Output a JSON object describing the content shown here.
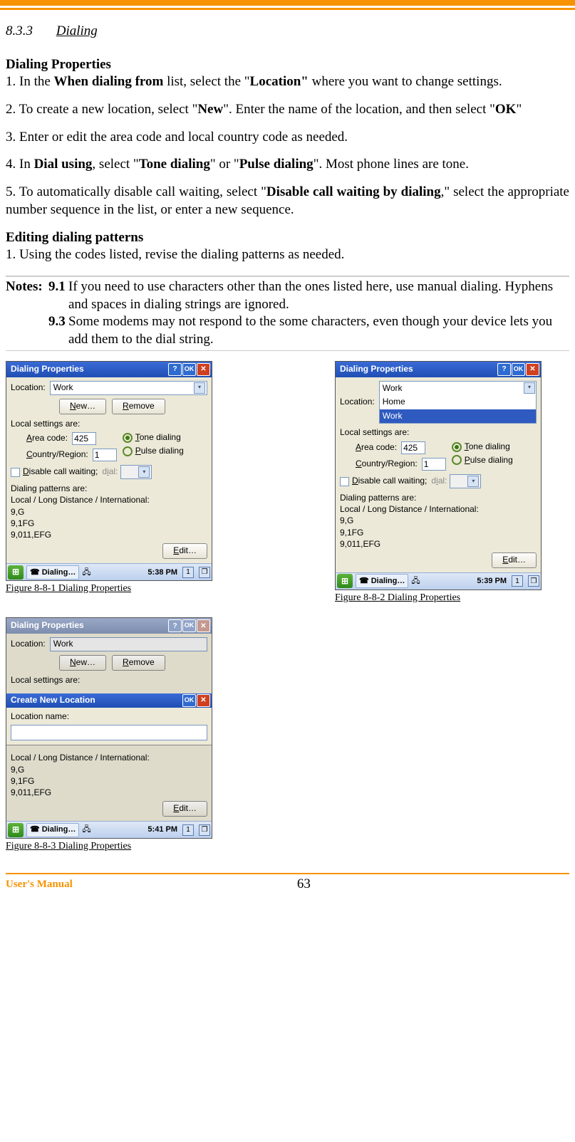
{
  "section": {
    "num": "8.3.3",
    "title": "Dialing"
  },
  "h1": "Dialing Properties",
  "steps": {
    "s1a": "1. In the ",
    "s1b": "When dialing from",
    "s1c": " list, select the \"",
    "s1d": "Location\"",
    "s1e": " where you want to change settings.",
    "s2a": "2. To create a new location, select \"",
    "s2b": "New",
    "s2c": "\". Enter the name of the location, and then select \"",
    "s2d": "OK",
    "s2e": "\"",
    "s3": "3. Enter or edit the area code and local country code as needed.",
    "s4a": "4. In ",
    "s4b": "Dial using",
    "s4c": ", select \"",
    "s4d": "Tone dialing",
    "s4e": "\" or \"",
    "s4f": "Pulse dialing",
    "s4g": "\". Most phone lines are tone.",
    "s5a": "5. To automatically disable call waiting, select \"",
    "s5b": "Disable call waiting by dialing",
    "s5c": ",\" select the appropriate number sequence in the list, or enter a new sequence."
  },
  "h2": "Editing dialing patterns",
  "edit1": "1. Using the codes listed, revise the dialing patterns as needed.",
  "notes": {
    "label": "Notes:",
    "n1num": "9.1",
    "n1": "If you need to use characters other than the ones listed here, use manual dialing. Hyphens and spaces in dialing strings are ignored.",
    "n2num": "9.3",
    "n2": "Some modems may not respond to the some characters, even though your device lets you add them to the dial string."
  },
  "dlg": {
    "title": "Dialing Properties",
    "help": "?",
    "ok": "OK",
    "close": "✕",
    "location_lbl": "Location:",
    "location_val": "Work",
    "opts": [
      "Home",
      "Work"
    ],
    "new_u": "N",
    "new_rest": "ew…",
    "remove_u": "R",
    "remove_rest": "emove",
    "local_settings": "Local settings are:",
    "area_lbl": "Area code:",
    "area_val": "425",
    "area_u": "A",
    "country_lbl": "ountry/Region:",
    "country_val": "1",
    "country_u": "C",
    "tone_u": "T",
    "tone_rest": "one dialing",
    "pulse_u": "P",
    "pulse_rest": "ulse dialing",
    "disable_u": "D",
    "disable_rest": "isable call waiting;",
    "dial_lbl": "dial:",
    "dial_u": "i",
    "patterns_lbl": "Dialing patterns are:",
    "patterns_sub": "Local / Long Distance / International:",
    "p1": "9,G",
    "p2": "9,1FG",
    "p3": "9,011,EFG",
    "edit_u": "E",
    "edit_rest": "dit…",
    "taskbtn": "Dialing…",
    "time1": "5:38 PM",
    "time2": "5:39 PM",
    "time3": "5:41 PM",
    "one": "1",
    "newloc_title": "Create New Location",
    "newloc_lbl": "Location name:"
  },
  "cap1": "Figure 8-8-1 Dialing Properties ",
  "cap2": "Figure 8-8-2 Dialing Properties",
  "cap3": "Figure 8-8-3 Dialing Properties",
  "footer": {
    "um": "User's Manual",
    "page": "63"
  }
}
